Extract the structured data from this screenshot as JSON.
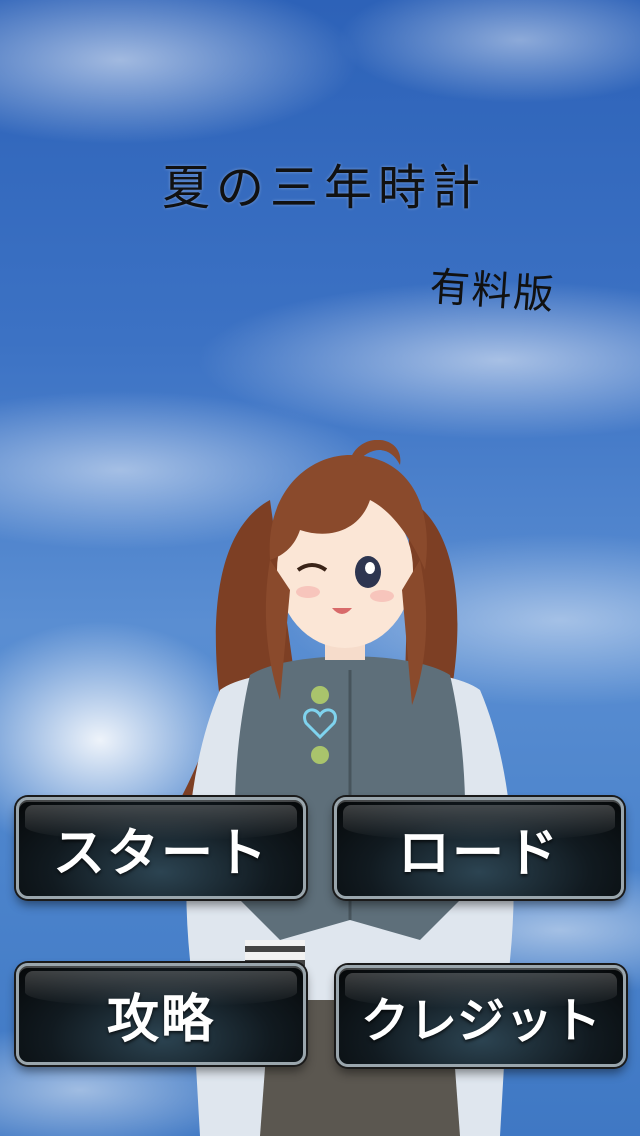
{
  "title": {
    "main": "夏の三年時計",
    "edition": "有料版"
  },
  "menu": {
    "start_label": "スタート",
    "load_label": "ロード",
    "guide_label": "攻略",
    "credits_label": "クレジット"
  },
  "colors": {
    "sky_top": "#2d62b8",
    "sky_mid": "#5a8ed2",
    "button_face": "#111a20",
    "button_border": "#9aa6ad",
    "button_text": "#ffffff",
    "hair": "#8a4a2c",
    "vest": "#5e6f7a"
  },
  "icons": {
    "character": "anime-girl-illustration"
  }
}
